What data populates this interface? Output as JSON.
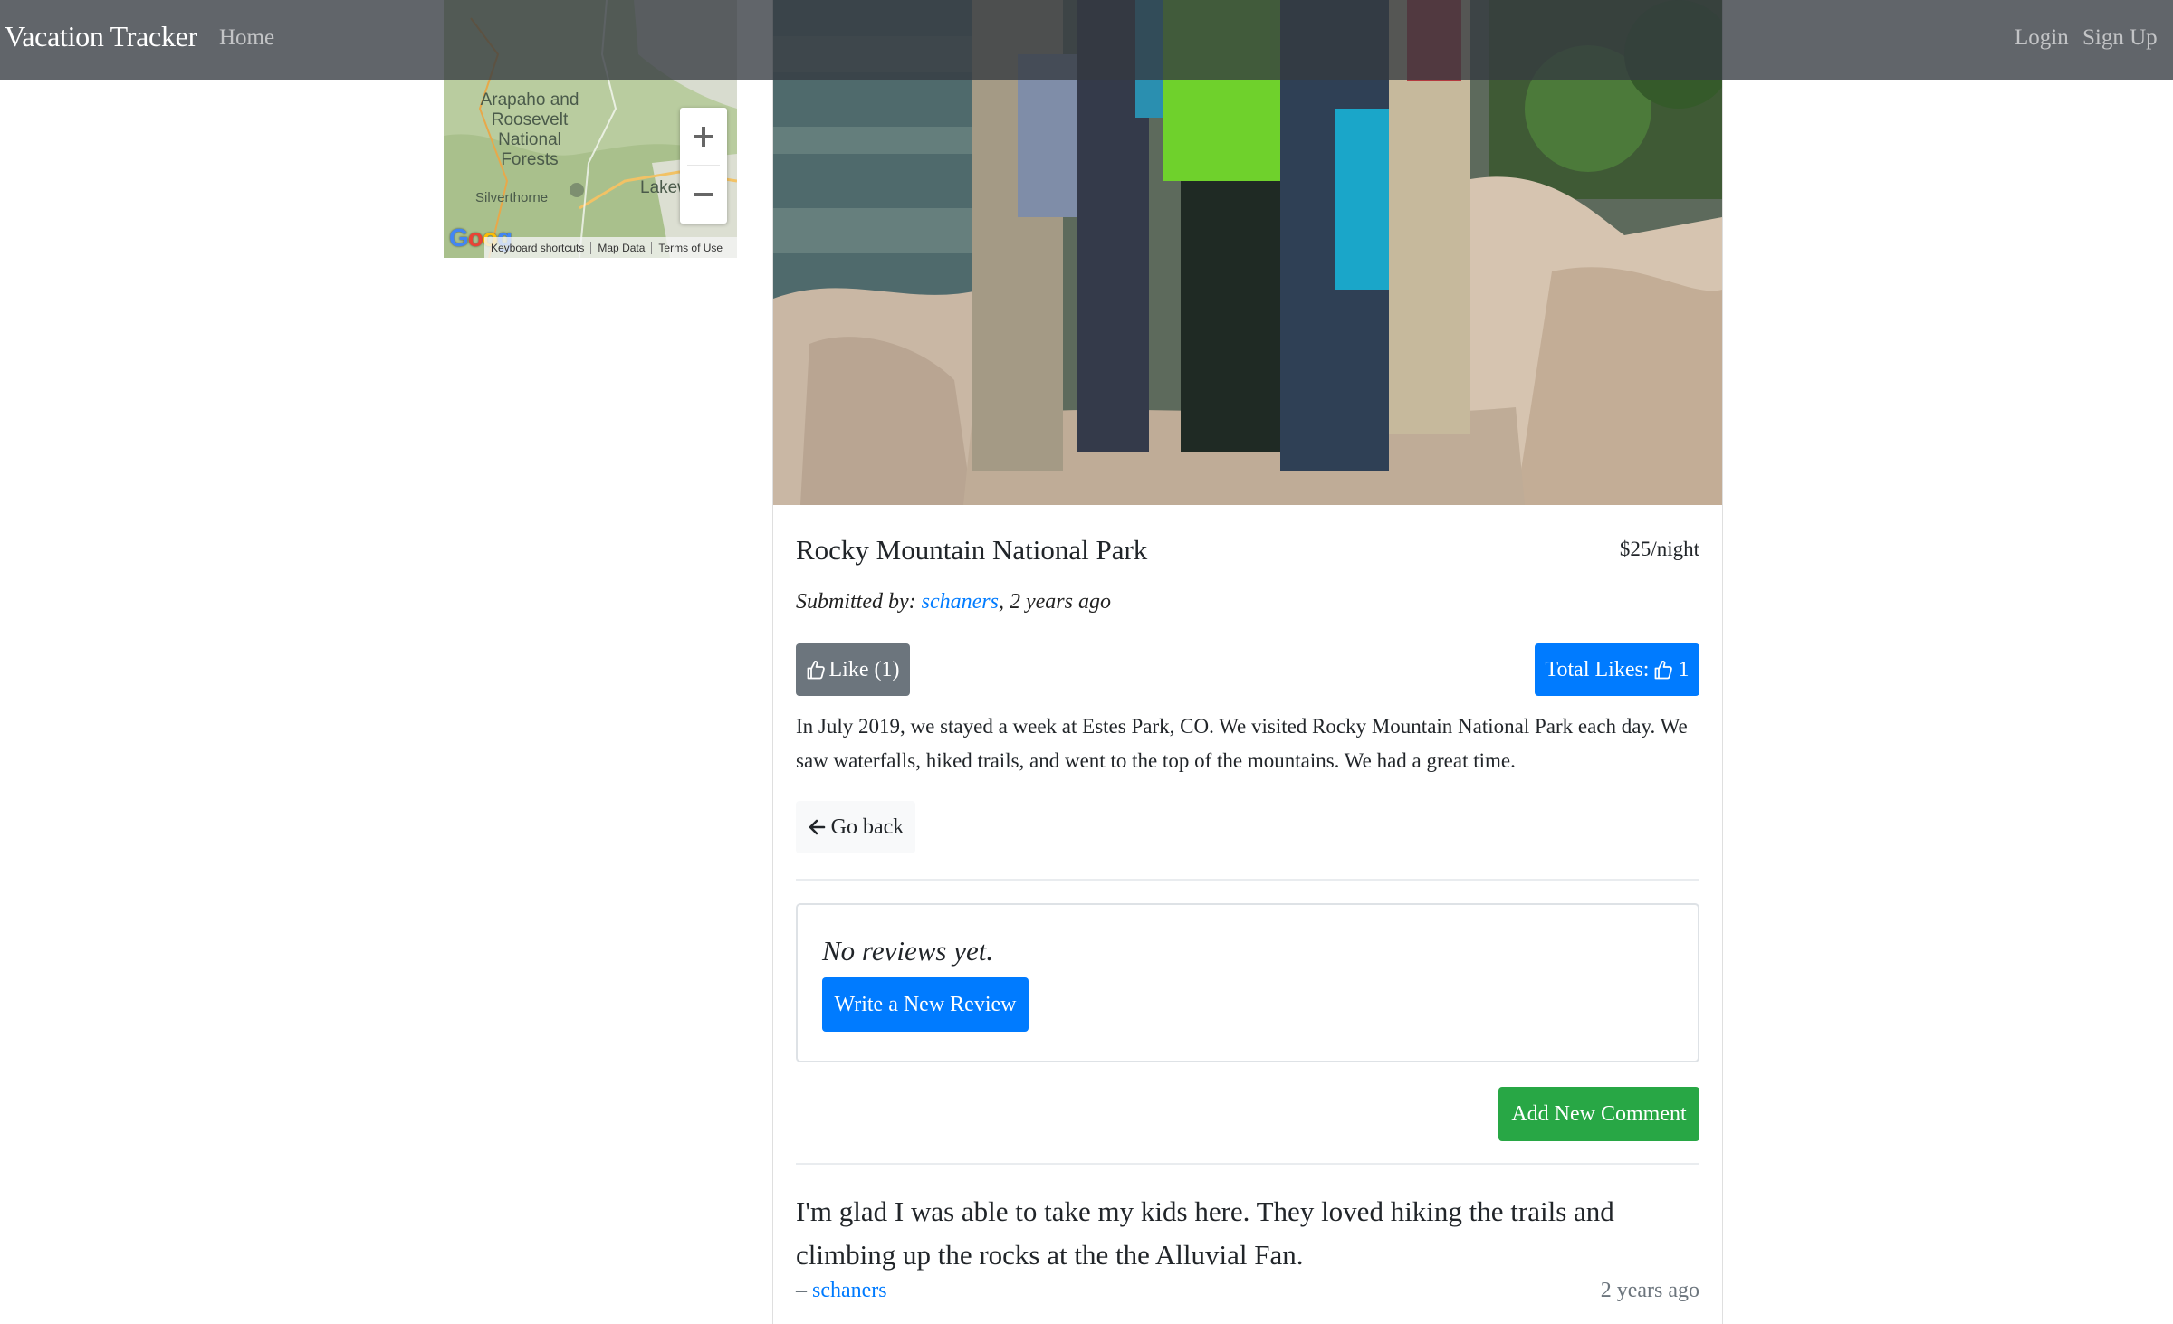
{
  "navbar": {
    "brand": "Vacation Tracker",
    "home": "Home",
    "login": "Login",
    "signup": "Sign Up"
  },
  "map": {
    "labels": {
      "forest": "Arapaho and\nRoosevelt\nNational\nForests",
      "silverthorne": "Silverthorne",
      "lakewood": "Lakew"
    },
    "zoom_in": "+",
    "zoom_out": "−",
    "logo": "Google",
    "footer": {
      "shortcuts": "Keyboard shortcuts",
      "map_data": "Map Data",
      "terms": "Terms of Use"
    }
  },
  "campground": {
    "name": "Rocky Mountain National Park",
    "price": "$25/night",
    "submitted_prefix": "Submitted by: ",
    "author": "schaners",
    "submitted_suffix": ", 2 years ago",
    "like_label": "Like (1)",
    "total_likes_label": "Total Likes:",
    "total_likes_count": "1",
    "description": "In July 2019, we stayed a week at Estes Park, CO. We visited Rocky Mountain National Park each day. We saw waterfalls, hiked trails, and went to the top of the mountains. We had a great time.",
    "go_back": "Go back"
  },
  "reviews": {
    "empty_text": "No reviews yet.",
    "write_button": "Write a New Review"
  },
  "comments": {
    "add_button": "Add New Comment",
    "items": [
      {
        "text": "I'm glad I was able to take my kids here. They loved hiking the trails and climbing up the rocks at the the Alluvial Fan.",
        "author_prefix": "– ",
        "author": "schaners",
        "time": "2 years ago"
      }
    ]
  },
  "colors": {
    "navbar": "#343a40",
    "primary": "#007bff",
    "secondary": "#6c757d",
    "success": "#28a745",
    "light": "#f8f9fa"
  },
  "icons": [
    "thumbs-up-icon",
    "arrow-left-icon",
    "plus-icon",
    "minus-icon"
  ]
}
